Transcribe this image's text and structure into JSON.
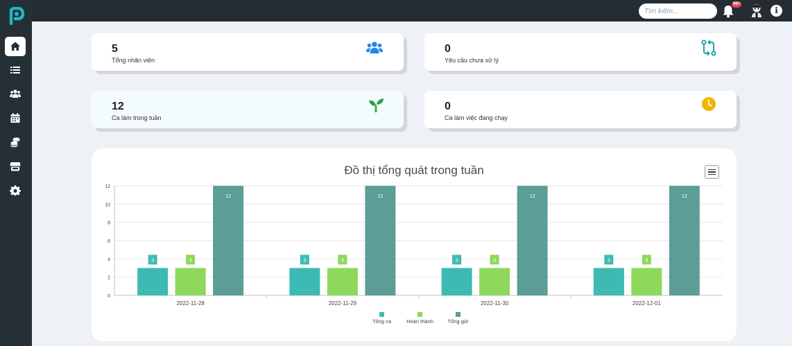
{
  "topbar": {
    "search_placeholder": "Tìm kiếm...",
    "notification_badge": "99+",
    "info_label": "i"
  },
  "sidebar": {
    "items": [
      {
        "name": "home",
        "active": true
      },
      {
        "name": "list",
        "active": false
      },
      {
        "name": "users",
        "active": false
      },
      {
        "name": "calendar",
        "active": false
      },
      {
        "name": "coins",
        "active": false
      },
      {
        "name": "store",
        "active": false
      },
      {
        "name": "settings",
        "active": false
      }
    ]
  },
  "stats": [
    {
      "value": "5",
      "label": "Tổng nhân viên",
      "icon": "users-icon",
      "color": "#1e88e5"
    },
    {
      "value": "0",
      "label": "Yêu cầu chưa xử lý",
      "icon": "git-compare-icon",
      "color": "#1aa3b0"
    },
    {
      "value": "12",
      "label": "Ca làm trong tuần",
      "icon": "seedling-icon",
      "color": "#2e9e3f"
    },
    {
      "value": "0",
      "label": "Ca làm việc đang chạy",
      "icon": "clock-icon",
      "color": "#f4b400"
    }
  ],
  "chart_data": {
    "type": "bar",
    "title": "Đồ thị tổng quát trong tuần",
    "categories": [
      "2022-11-28",
      "2022-11-29",
      "2022-11-30",
      "2022-12-01"
    ],
    "series": [
      {
        "name": "Tổng ca",
        "values": [
          3,
          3,
          3,
          3
        ],
        "color": "#3dbab3"
      },
      {
        "name": "Hoàn thành",
        "values": [
          3,
          3,
          3,
          3
        ],
        "color": "#8ed85c"
      },
      {
        "name": "Tổng giờ",
        "values": [
          12,
          12,
          12,
          12
        ],
        "color": "#5c9e97"
      }
    ],
    "ylim": [
      0,
      12
    ],
    "yticks": [
      0,
      2,
      4,
      6,
      8,
      10,
      12
    ],
    "grid": true,
    "data_labels": true,
    "legend": "bottom-center"
  }
}
